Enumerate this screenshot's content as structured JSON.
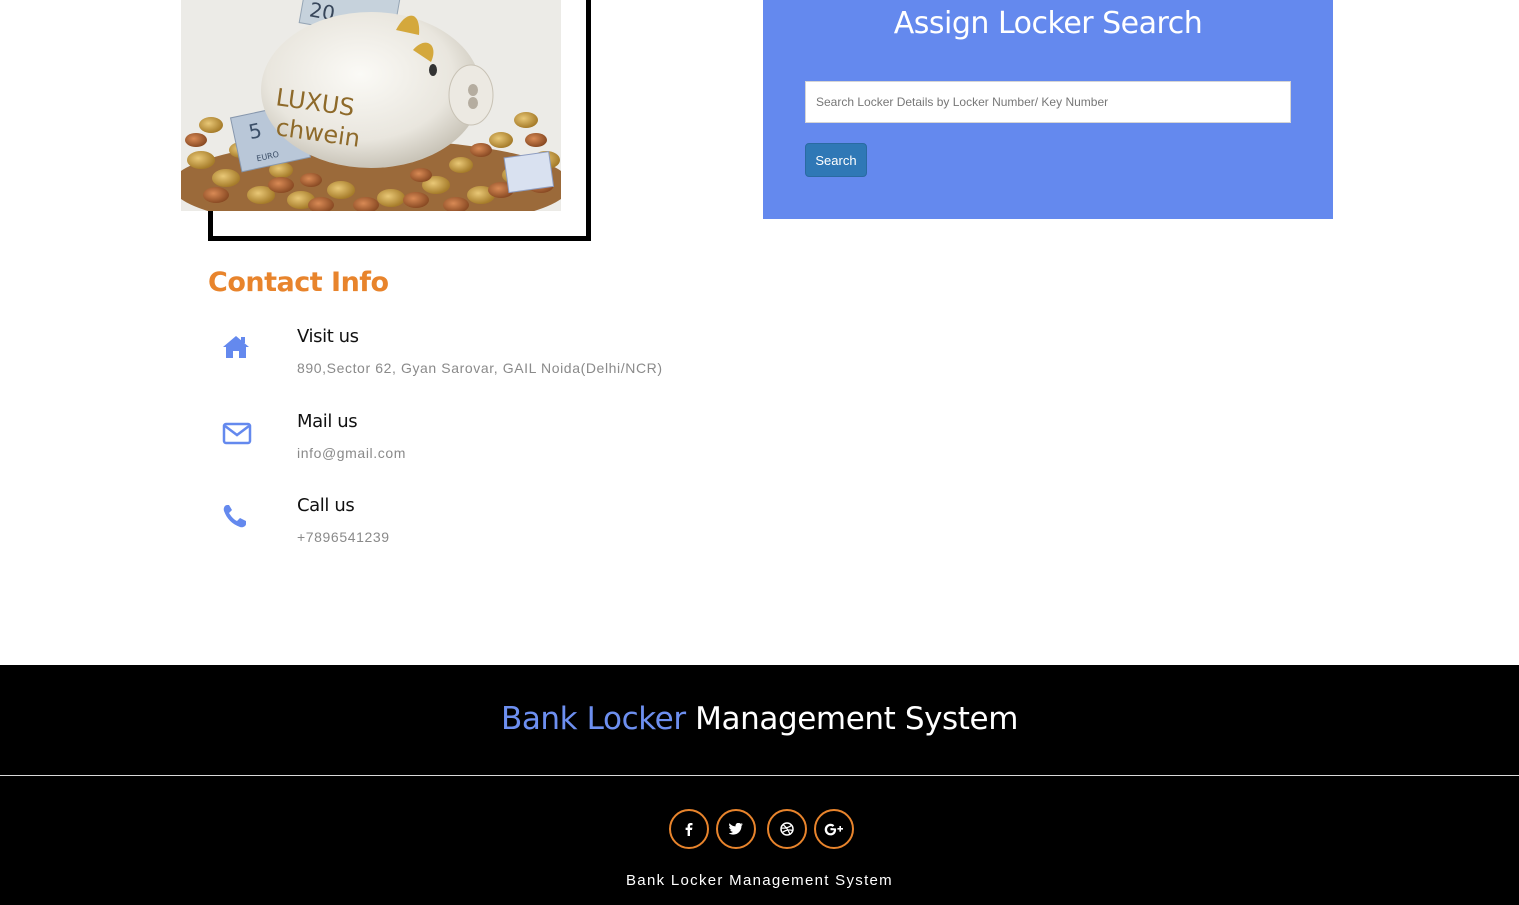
{
  "search_panel": {
    "title": "Assign Locker Search",
    "placeholder": "Search Locker Details by Locker Number/ Key Number",
    "value": "",
    "button_label": "Search",
    "background": "#6489ee"
  },
  "image": {
    "alt": "Piggy bank on coins",
    "piggy_text_line1": "LUXUS",
    "piggy_text_line2": "chwein",
    "note_value_top": "20",
    "note_value_left": "5",
    "note_currency": "EURO"
  },
  "contact": {
    "heading": "Contact Info",
    "heading_color": "#e8842c",
    "items": [
      {
        "icon": "home-icon",
        "label": "Visit us",
        "value": "890,Sector 62, Gyan Sarovar, GAIL Noida(Delhi/NCR)"
      },
      {
        "icon": "envelope-icon",
        "label": "Mail us",
        "value": "info@gmail.com"
      },
      {
        "icon": "phone-icon",
        "label": "Call us",
        "value": "+7896541239"
      }
    ],
    "icon_color": "#6489ee"
  },
  "footer": {
    "title_accent": "Bank Locker",
    "title_rest": "Management System",
    "accent_color": "#6d8ff0",
    "social": [
      {
        "icon": "facebook-icon",
        "label": "Facebook"
      },
      {
        "icon": "twitter-icon",
        "label": "Twitter"
      },
      {
        "icon": "dribbble-icon",
        "label": "Dribbble"
      },
      {
        "icon": "google-plus-icon",
        "label": "Google Plus"
      }
    ],
    "social_border_color": "#e8842c",
    "copyright": "Bank Locker Management System"
  }
}
